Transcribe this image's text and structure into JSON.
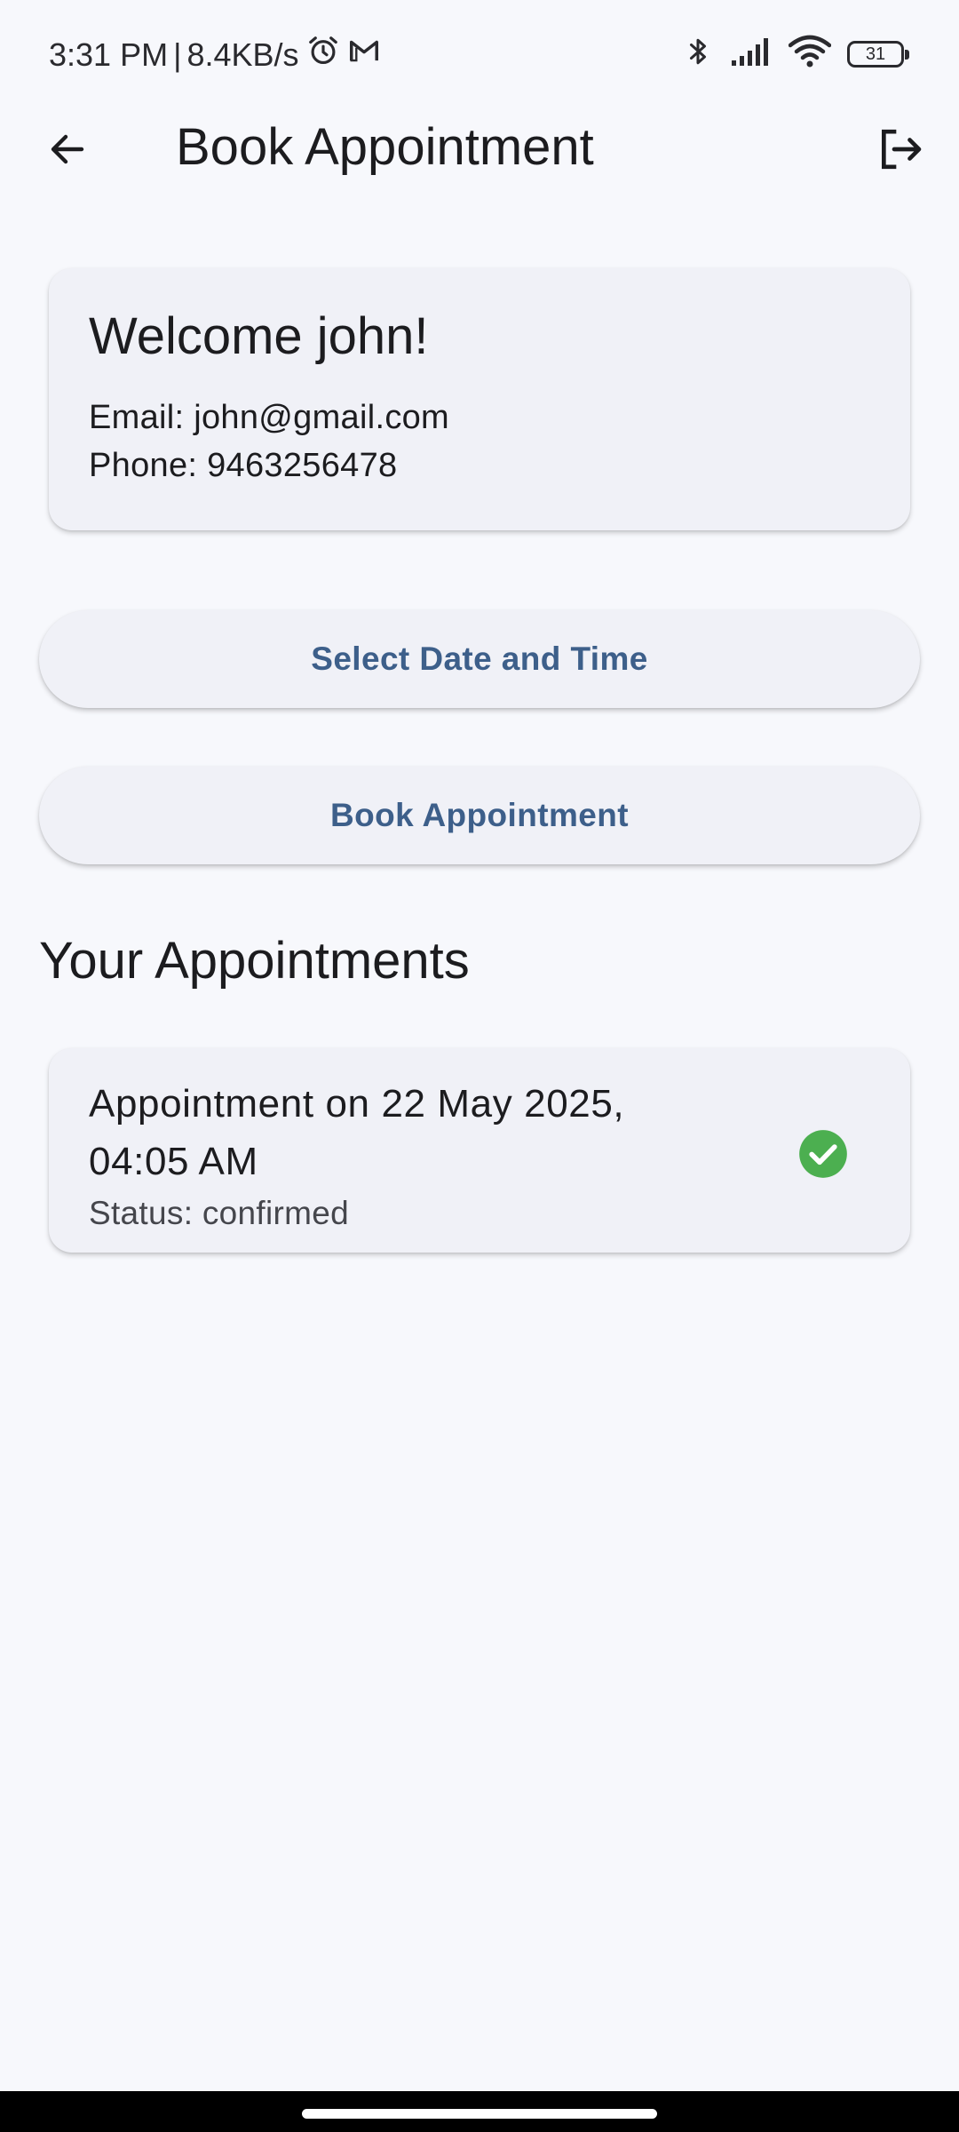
{
  "status_bar": {
    "time": "3:31 PM",
    "separator": "|",
    "network_speed": "8.4KB/s",
    "left_icons": [
      "alarm-icon",
      "gmail-icon"
    ],
    "right_icons": [
      "bluetooth-icon",
      "signal-icon",
      "wifi-icon",
      "battery-icon"
    ],
    "battery_level": "31"
  },
  "app_bar": {
    "title": "Book Appointment",
    "back_icon": "arrow-left-icon",
    "logout_icon": "logout-icon"
  },
  "profile_card": {
    "welcome": "Welcome john!",
    "email_line": "Email: john@gmail.com",
    "phone_line": "Phone: 9463256478"
  },
  "actions": {
    "select_datetime_label": "Select Date and Time",
    "book_label": "Book Appointment"
  },
  "appointments": {
    "heading": "Your Appointments",
    "items": [
      {
        "title": "Appointment on 22 May 2025, 04:05 AM",
        "status": "Status: confirmed",
        "status_icon": "check-circle-icon"
      }
    ]
  },
  "colors": {
    "background": "#f7f8fc",
    "card": "#f0f1f7",
    "button_text": "#3d5f8a",
    "confirmed": "#4caf50"
  }
}
